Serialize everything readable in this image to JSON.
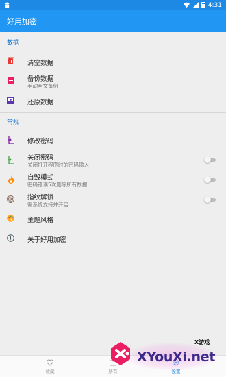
{
  "status_bar": {
    "time": "4:31"
  },
  "app_bar": {
    "title": "好用加密"
  },
  "sections": [
    {
      "header": "数据",
      "items": [
        {
          "icon": "trash-icon",
          "title": "清空数据",
          "subtitle": ""
        },
        {
          "icon": "backup-icon",
          "title": "备份数据",
          "subtitle": "手动明文备份"
        },
        {
          "icon": "restore-icon",
          "title": "还原数据",
          "subtitle": ""
        }
      ]
    },
    {
      "header": "常规",
      "items": [
        {
          "icon": "edit-password-icon",
          "title": "修改密码",
          "subtitle": ""
        },
        {
          "icon": "exit-lock-icon",
          "title": "关闭密码",
          "subtitle": "关闭打开程序时的密码输入",
          "toggle": false
        },
        {
          "icon": "fire-icon",
          "title": "自毁模式",
          "subtitle": "密码错误5次删除所有数据",
          "toggle": false
        },
        {
          "icon": "fingerprint-icon",
          "title": "指纹解锁",
          "subtitle": "需系统支持并开启",
          "toggle": false
        },
        {
          "icon": "palette-icon",
          "title": "主题风格",
          "subtitle": ""
        },
        {
          "icon": "info-icon",
          "title": "关于好用加密",
          "subtitle": ""
        }
      ]
    }
  ],
  "bottom_nav": [
    {
      "icon": "heart-icon",
      "label": "收藏"
    },
    {
      "icon": "folder-icon",
      "label": "所有"
    },
    {
      "icon": "settings-icon",
      "label": "设置"
    }
  ],
  "watermark": {
    "tag": "X游戏",
    "text": "XYouXi.net"
  },
  "colors": {
    "primary": "#2196f3",
    "status_bar": "#1e88e5",
    "accent_header": "#1976d2"
  }
}
